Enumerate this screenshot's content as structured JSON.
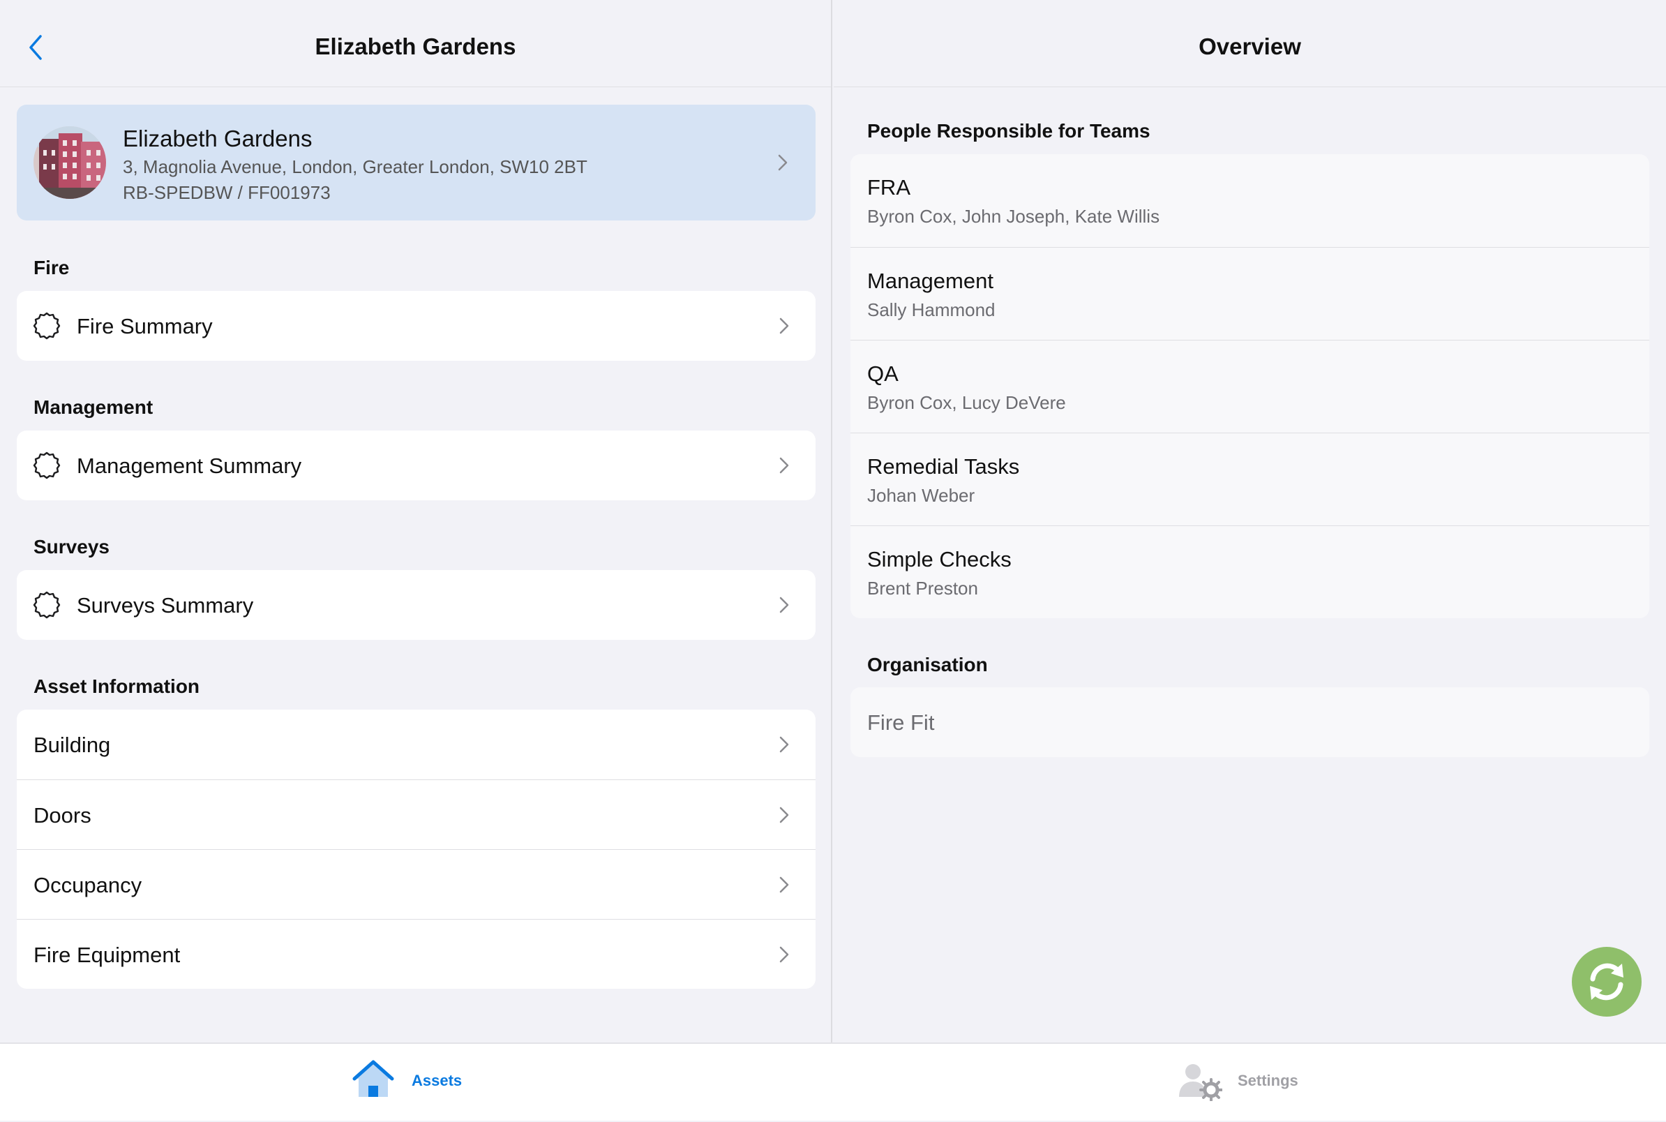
{
  "left": {
    "title": "Elizabeth Gardens",
    "asset": {
      "name": "Elizabeth Gardens",
      "address": "3, Magnolia Avenue, London, Greater London, SW10 2BT",
      "reference": "RB-SPEDBW / FF001973"
    },
    "sections": {
      "fire": {
        "header": "Fire",
        "item": "Fire Summary"
      },
      "management": {
        "header": "Management",
        "item": "Management Summary"
      },
      "surveys": {
        "header": "Surveys",
        "item": "Surveys Summary"
      },
      "asset_info": {
        "header": "Asset Information",
        "items": [
          "Building",
          "Doors",
          "Occupancy",
          "Fire Equipment"
        ]
      }
    }
  },
  "right": {
    "title": "Overview",
    "teams_header": "People Responsible for Teams",
    "teams": [
      {
        "name": "FRA",
        "people": "Byron Cox, John Joseph, Kate Willis"
      },
      {
        "name": "Management",
        "people": "Sally Hammond"
      },
      {
        "name": "QA",
        "people": "Byron Cox, Lucy DeVere"
      },
      {
        "name": "Remedial Tasks",
        "people": "Johan Weber"
      },
      {
        "name": "Simple Checks",
        "people": "Brent Preston"
      }
    ],
    "organisation_header": "Organisation",
    "organisation": "Fire Fit"
  },
  "tabbar": {
    "assets_label": "Assets",
    "settings_label": "Settings"
  },
  "colors": {
    "accent": "#0a7ae0",
    "asset_card": "#d6e3f4",
    "refresh_button": "#8fbf6a",
    "inactive_tab": "#a0a0a5"
  },
  "icons": {
    "back": "chevron-left-icon",
    "summary": "badge-outline-icon",
    "row_chevron": "chevron-right-icon",
    "refresh": "refresh-icon",
    "assets_tab": "house-icon",
    "settings_tab": "person-gear-icon"
  }
}
